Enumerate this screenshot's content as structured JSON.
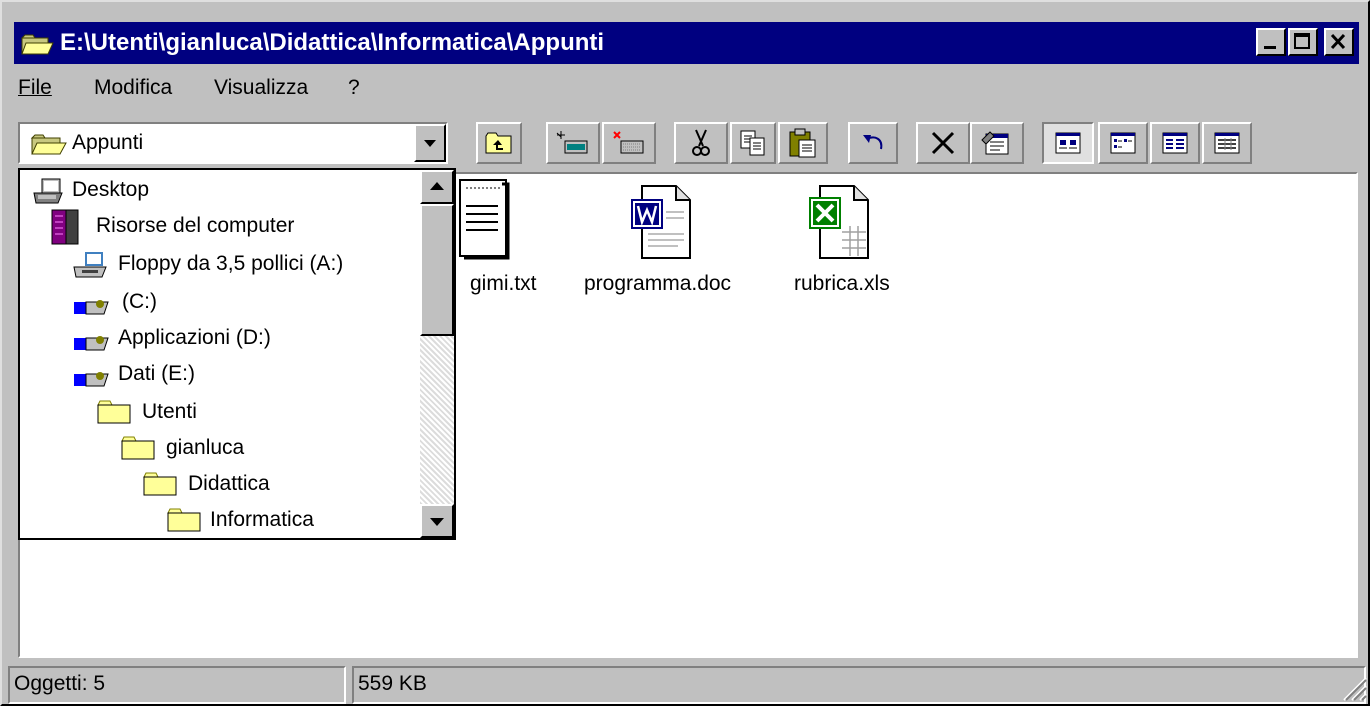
{
  "window": {
    "title": "E:\\Utenti\\gianluca\\Didattica\\Informatica\\Appunti",
    "controls": [
      "minimize",
      "maximize",
      "close"
    ]
  },
  "menu": {
    "items": [
      {
        "label": "File"
      },
      {
        "label": "Modifica"
      },
      {
        "label": "Visualizza"
      },
      {
        "label": "?"
      }
    ]
  },
  "address": {
    "current": "Appunti",
    "icon": "folder-open-icon"
  },
  "toolbar": {
    "buttons": [
      {
        "name": "up-folder",
        "icon": "up-folder-icon"
      },
      {
        "name": "map-network-drive",
        "icon": "map-drive-icon"
      },
      {
        "name": "disconnect-network-drive",
        "icon": "disconnect-drive-icon"
      },
      {
        "name": "cut",
        "icon": "scissors-icon"
      },
      {
        "name": "copy",
        "icon": "copy-icon"
      },
      {
        "name": "paste",
        "icon": "paste-icon"
      },
      {
        "name": "undo",
        "icon": "undo-icon"
      },
      {
        "name": "delete",
        "icon": "delete-x-icon"
      },
      {
        "name": "properties",
        "icon": "properties-icon"
      },
      {
        "name": "large-icons",
        "icon": "large-icons-view-icon",
        "pressed": true
      },
      {
        "name": "small-icons",
        "icon": "small-icons-view-icon"
      },
      {
        "name": "list",
        "icon": "list-view-icon"
      },
      {
        "name": "details",
        "icon": "details-view-icon"
      }
    ]
  },
  "tree": {
    "items": [
      {
        "label": "Desktop",
        "icon": "desktop-icon",
        "level": 0
      },
      {
        "label": "Risorse del computer",
        "icon": "computer-icon",
        "level": 1
      },
      {
        "label": "Floppy da 3,5 pollici (A:)",
        "icon": "floppy-drive-icon",
        "level": 2
      },
      {
        "label": "(C:)",
        "icon": "hard-drive-icon",
        "level": 2
      },
      {
        "label": "Applicazioni (D:)",
        "icon": "hard-drive-icon",
        "level": 2
      },
      {
        "label": "Dati (E:)",
        "icon": "hard-drive-icon",
        "level": 2
      },
      {
        "label": "Utenti",
        "icon": "folder-icon",
        "level": 3
      },
      {
        "label": "gianluca",
        "icon": "folder-icon",
        "level": 4
      },
      {
        "label": "Didattica",
        "icon": "folder-icon",
        "level": 5
      },
      {
        "label": "Informatica",
        "icon": "folder-icon",
        "level": 6
      }
    ]
  },
  "files": [
    {
      "name": "gimi.txt",
      "icon": "text-file-icon"
    },
    {
      "name": "programma.doc",
      "icon": "word-document-icon"
    },
    {
      "name": "rubrica.xls",
      "icon": "excel-spreadsheet-icon"
    }
  ],
  "status": {
    "objects": "Oggetti: 5",
    "size": "559 KB"
  },
  "colors": {
    "titlebar": "#000080",
    "face": "#c0c0c0",
    "folder": "#ffff99"
  }
}
